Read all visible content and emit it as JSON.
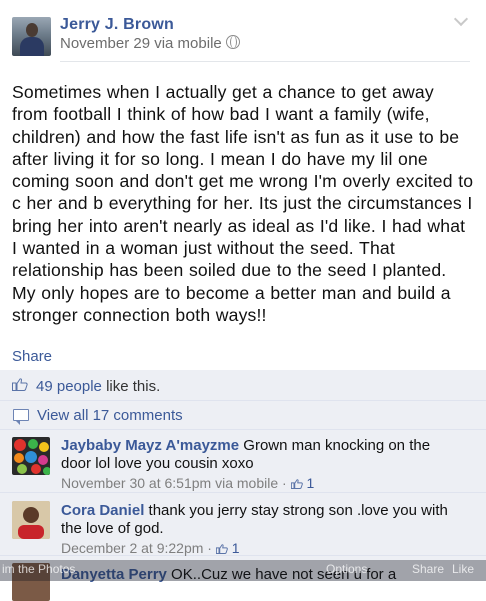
{
  "post": {
    "author": "Jerry J. Brown",
    "meta": "November 29 via mobile",
    "text": "Sometimes when I actually get a chance to get away from football I think of how bad I want a family (wife, children) and how the fast life isn't as fun as it use to be after living it for so long. I mean I do have my lil one coming soon and don't get me wrong I'm overly excited to c her and b everything for her. Its just the circumstances I bring her into aren't nearly as ideal as I'd like. I had what I wanted in a woman just without the seed. That relationship has been soiled due to the seed I planted. My only hopes are to become a better man and build a stronger connection both ways!!"
  },
  "actions": {
    "share": "Share"
  },
  "likes": {
    "count": "49 people",
    "suffix": " like this."
  },
  "view_all": "View all 17 comments",
  "comments": [
    {
      "name": "Jaybaby Mayz A'mayzme",
      "text": " Grown man knocking on the door lol love you cousin xoxo",
      "meta": "November 30 at 6:51pm via mobile · ",
      "likes": "1"
    },
    {
      "name": "Cora Daniel",
      "text": " thank you jerry stay strong son .love you with the love of god.",
      "meta": "December 2 at 9:22pm · ",
      "likes": "1"
    },
    {
      "name": "Danyetta Perry",
      "text": " OK..Cuz we have not seen u for a"
    }
  ],
  "overlay": {
    "left": "im the Photos",
    "middle": "Options",
    "share": "Share",
    "like": "Like"
  },
  "colors": {
    "link": "#3b5998",
    "feedback_bg": "#edeff4"
  }
}
